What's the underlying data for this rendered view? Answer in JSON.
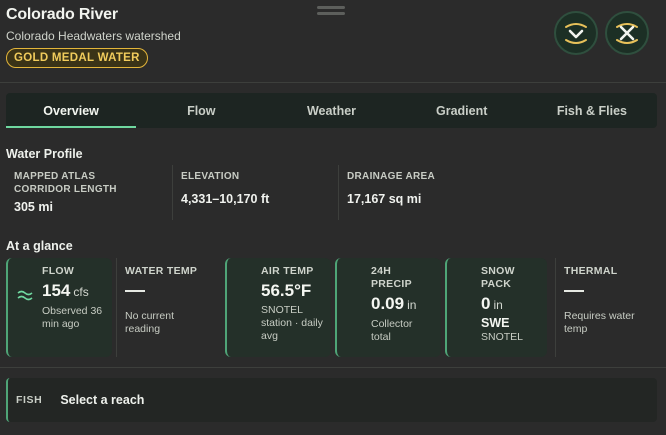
{
  "header": {
    "title": "Colorado River",
    "subtitle": "Colorado Headwaters watershed",
    "badge": "GOLD MEDAL WATER",
    "collapse_icon": "chevron-down-icon",
    "close_icon": "close-icon"
  },
  "tabs": [
    {
      "label": "Overview",
      "active": true
    },
    {
      "label": "Flow"
    },
    {
      "label": "Weather"
    },
    {
      "label": "Gradient"
    },
    {
      "label": "Fish & Flies"
    }
  ],
  "profile": {
    "title": "Water Profile",
    "items": [
      {
        "label": "MAPPED ATLAS CORRIDOR LENGTH",
        "value": "305 mi"
      },
      {
        "label": "ELEVATION",
        "value": "4,331–10,170 ft"
      },
      {
        "label": "DRAINAGE AREA",
        "value": "17,167 sq mi"
      }
    ]
  },
  "glance": {
    "title": "At a glance",
    "flow": {
      "label": "FLOW",
      "value": "154",
      "unit": "cfs",
      "note": "Observed 36 min ago",
      "icon": "water-waves-icon"
    },
    "water_temp": {
      "label": "WATER TEMP",
      "note": "No current reading"
    },
    "air_temp": {
      "label": "AIR TEMP",
      "value": "56.5°F",
      "note": "SNOTEL station · daily avg"
    },
    "precip": {
      "label": "24H PRECIP",
      "value": "0.09",
      "unit": "in",
      "note": "Collector total"
    },
    "snow": {
      "label": "SNOW PACK",
      "value": "0",
      "unit": "in",
      "value2": "SWE",
      "note": "SNOTEL"
    },
    "thermal": {
      "label": "THERMAL",
      "note": "Requires water temp"
    }
  },
  "fish": {
    "label": "FISH",
    "value": "Select a reach"
  },
  "colors": {
    "accent": "#6fd8a0",
    "badge": "#e3b53a",
    "background": "#2b2b2b"
  }
}
